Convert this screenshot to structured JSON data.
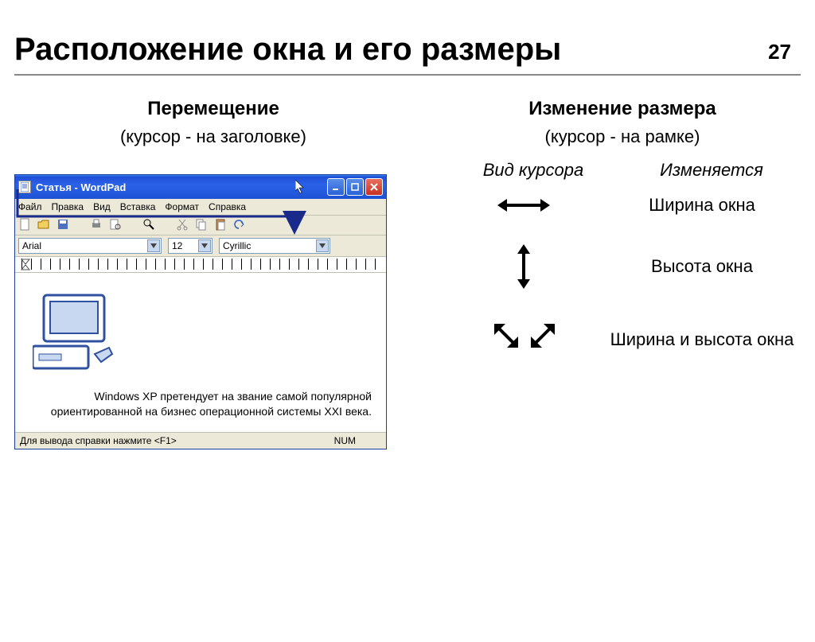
{
  "page_number": "27",
  "title": "Расположение окна и его размеры",
  "left": {
    "heading": "Перемещение",
    "sub": "(курсор - на заголовке)"
  },
  "right": {
    "heading": "Изменение размера",
    "sub": "(курсор - на рамке)",
    "col1": "Вид курсора",
    "col2": "Изменяется",
    "rows": [
      {
        "desc": "Ширина окна"
      },
      {
        "desc": "Высота окна"
      },
      {
        "desc": "Ширина и высота окна"
      }
    ]
  },
  "wordpad": {
    "title": "Статья - WordPad",
    "menu": [
      "Файл",
      "Правка",
      "Вид",
      "Вставка",
      "Формат",
      "Справка"
    ],
    "font": "Arial",
    "size": "12",
    "charset": "Cyrillic",
    "doc_text": "Windows XP претендует на звание самой популярной ориентированной на бизнес операционной системы XXI века.",
    "status": "Для вывода справки нажмите <F1>",
    "status_num": "NUM"
  }
}
